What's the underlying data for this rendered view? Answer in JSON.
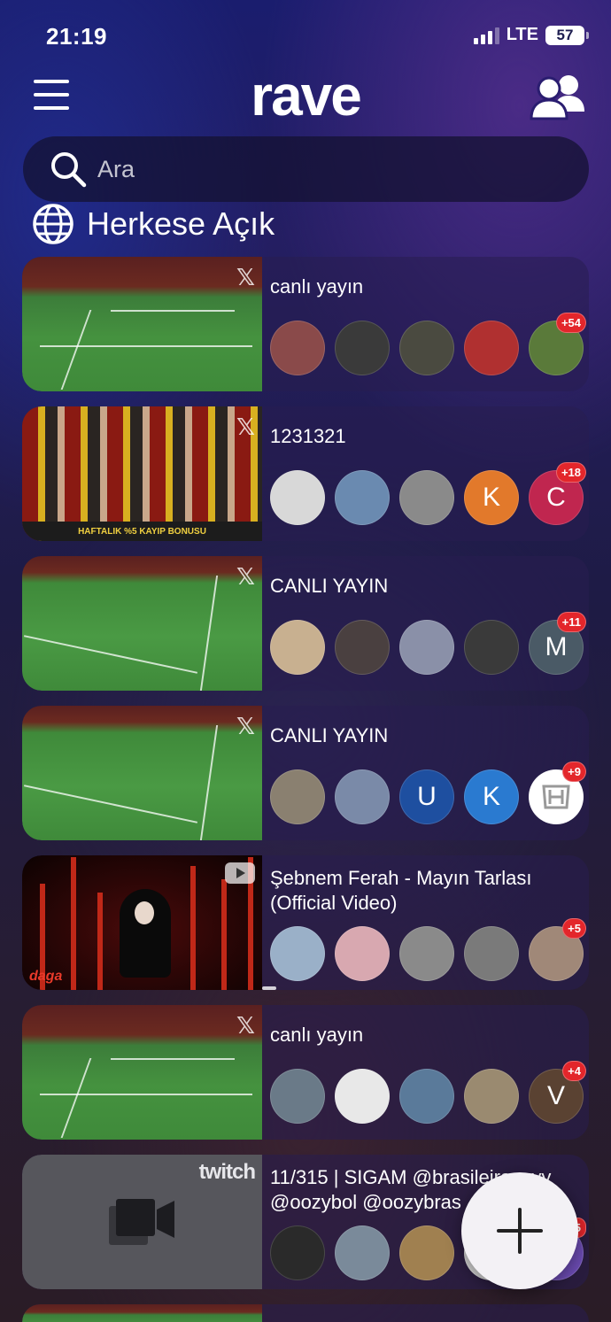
{
  "status": {
    "time": "21:19",
    "network": "LTE",
    "battery": "57"
  },
  "header": {
    "logo": "rave",
    "menu_icon": "hamburger-icon",
    "friends_icon": "people-icon"
  },
  "search": {
    "placeholder": "Ara",
    "value": ""
  },
  "section": {
    "title": "Herkese Açık",
    "icon": "globe-icon"
  },
  "rooms": [
    {
      "title": "canlı yayın",
      "platform": "x",
      "thumb": "field",
      "badge": "+54",
      "avatars": [
        {
          "color": "#8a4a4a"
        },
        {
          "color": "#3a3a3a"
        },
        {
          "color": "#4a4a40"
        },
        {
          "color": "#b03030"
        },
        {
          "color": "#5a7a3a"
        }
      ]
    },
    {
      "title": "1231321",
      "platform": "x",
      "thumb": "crowd",
      "badge": "+18",
      "banner": "HAFTALIK %5 KAYIP BONUSU",
      "avatars": [
        {
          "color": "#d8d8d8"
        },
        {
          "color": "#6a8ab0"
        },
        {
          "color": "#8a8a8a"
        },
        {
          "color": "#e2792b",
          "letter": "K"
        },
        {
          "color": "#c0264f",
          "letter": "C"
        }
      ]
    },
    {
      "title": "CANLI YAYIN",
      "platform": "x",
      "thumb": "field",
      "badge": "+11",
      "avatars": [
        {
          "color": "#c8b090"
        },
        {
          "color": "#4a4040"
        },
        {
          "color": "#8a90a8"
        },
        {
          "color": "#3a3a3a"
        },
        {
          "color": "#4a5a66",
          "letter": "M"
        }
      ]
    },
    {
      "title": "CANLI YAYIN",
      "platform": "x",
      "thumb": "field",
      "badge": "+9",
      "avatars": [
        {
          "color": "#8a8070"
        },
        {
          "color": "#7a8aa8"
        },
        {
          "color": "#1e4fa0",
          "letter": "U"
        },
        {
          "color": "#2a7ad0",
          "letter": "K"
        },
        {
          "color": "#ffffff"
        }
      ]
    },
    {
      "title": "Şebnem Ferah - Mayın Tarlası (Official Video)",
      "platform": "youtube",
      "thumb": "forest",
      "badge": "+5",
      "thumb_logo": "daga",
      "avatars": [
        {
          "color": "#9ab0c8"
        },
        {
          "color": "#d8a8b0"
        },
        {
          "color": "#8a8a8a"
        },
        {
          "color": "#7a7a7a"
        },
        {
          "color": "#a08878"
        }
      ]
    },
    {
      "title": "canlı yayın",
      "platform": "x",
      "thumb": "field",
      "badge": "+4",
      "avatars": [
        {
          "color": "#6a7a88"
        },
        {
          "color": "#e8e8e8"
        },
        {
          "color": "#5a7a9a"
        },
        {
          "color": "#9a8a70"
        },
        {
          "color": "#5a4232",
          "letter": "V"
        }
      ]
    },
    {
      "title": "11/315 | SIGAM @brasileiraozyy @oozybol @oozybras",
      "platform": "twitch",
      "thumb": "twitch",
      "badge": "5",
      "avatars": [
        {
          "color": "#2a2a2a"
        },
        {
          "color": "#7a8a9a"
        },
        {
          "color": "#a08050"
        },
        {
          "color": "#d0d0d0"
        },
        {
          "color": "#6a4ab0"
        }
      ]
    }
  ],
  "fab": {
    "icon": "plus-icon",
    "label": "+"
  }
}
